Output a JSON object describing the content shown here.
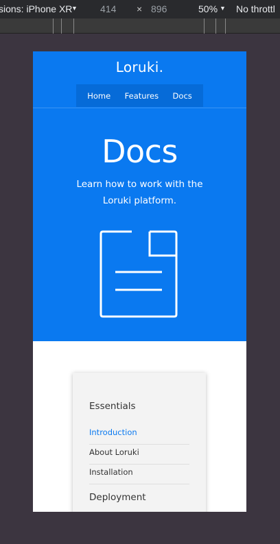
{
  "devtools": {
    "device": "sions: iPhone XR",
    "width": "414",
    "times": "×",
    "height": "896",
    "zoom": "50%",
    "throttle": "No throttl"
  },
  "site": {
    "brand": "Loruki.",
    "nav": [
      "Home",
      "Features",
      "Docs"
    ],
    "hero": {
      "title": "Docs",
      "subtitle": "Learn how to work with the Loruki platform."
    },
    "sidebar": {
      "section1": "Essentials",
      "items": [
        "Introduction",
        "About Loruki",
        "Installation"
      ],
      "section2": "Deployment"
    }
  },
  "colors": {
    "primary": "#0a79f0",
    "nav_bg": "#066bd8",
    "active_link": "#0a79f0"
  },
  "icons": {
    "document": "document-icon"
  }
}
